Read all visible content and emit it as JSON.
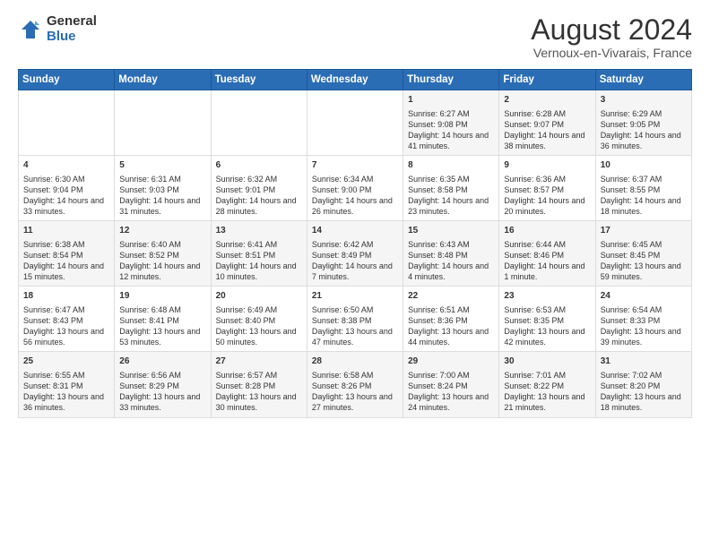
{
  "header": {
    "logo_general": "General",
    "logo_blue": "Blue",
    "month_year": "August 2024",
    "location": "Vernoux-en-Vivarais, France"
  },
  "weekdays": [
    "Sunday",
    "Monday",
    "Tuesday",
    "Wednesday",
    "Thursday",
    "Friday",
    "Saturday"
  ],
  "weeks": [
    [
      {
        "day": "",
        "content": ""
      },
      {
        "day": "",
        "content": ""
      },
      {
        "day": "",
        "content": ""
      },
      {
        "day": "",
        "content": ""
      },
      {
        "day": "1",
        "content": "Sunrise: 6:27 AM\nSunset: 9:08 PM\nDaylight: 14 hours and 41 minutes."
      },
      {
        "day": "2",
        "content": "Sunrise: 6:28 AM\nSunset: 9:07 PM\nDaylight: 14 hours and 38 minutes."
      },
      {
        "day": "3",
        "content": "Sunrise: 6:29 AM\nSunset: 9:05 PM\nDaylight: 14 hours and 36 minutes."
      }
    ],
    [
      {
        "day": "4",
        "content": "Sunrise: 6:30 AM\nSunset: 9:04 PM\nDaylight: 14 hours and 33 minutes."
      },
      {
        "day": "5",
        "content": "Sunrise: 6:31 AM\nSunset: 9:03 PM\nDaylight: 14 hours and 31 minutes."
      },
      {
        "day": "6",
        "content": "Sunrise: 6:32 AM\nSunset: 9:01 PM\nDaylight: 14 hours and 28 minutes."
      },
      {
        "day": "7",
        "content": "Sunrise: 6:34 AM\nSunset: 9:00 PM\nDaylight: 14 hours and 26 minutes."
      },
      {
        "day": "8",
        "content": "Sunrise: 6:35 AM\nSunset: 8:58 PM\nDaylight: 14 hours and 23 minutes."
      },
      {
        "day": "9",
        "content": "Sunrise: 6:36 AM\nSunset: 8:57 PM\nDaylight: 14 hours and 20 minutes."
      },
      {
        "day": "10",
        "content": "Sunrise: 6:37 AM\nSunset: 8:55 PM\nDaylight: 14 hours and 18 minutes."
      }
    ],
    [
      {
        "day": "11",
        "content": "Sunrise: 6:38 AM\nSunset: 8:54 PM\nDaylight: 14 hours and 15 minutes."
      },
      {
        "day": "12",
        "content": "Sunrise: 6:40 AM\nSunset: 8:52 PM\nDaylight: 14 hours and 12 minutes."
      },
      {
        "day": "13",
        "content": "Sunrise: 6:41 AM\nSunset: 8:51 PM\nDaylight: 14 hours and 10 minutes."
      },
      {
        "day": "14",
        "content": "Sunrise: 6:42 AM\nSunset: 8:49 PM\nDaylight: 14 hours and 7 minutes."
      },
      {
        "day": "15",
        "content": "Sunrise: 6:43 AM\nSunset: 8:48 PM\nDaylight: 14 hours and 4 minutes."
      },
      {
        "day": "16",
        "content": "Sunrise: 6:44 AM\nSunset: 8:46 PM\nDaylight: 14 hours and 1 minute."
      },
      {
        "day": "17",
        "content": "Sunrise: 6:45 AM\nSunset: 8:45 PM\nDaylight: 13 hours and 59 minutes."
      }
    ],
    [
      {
        "day": "18",
        "content": "Sunrise: 6:47 AM\nSunset: 8:43 PM\nDaylight: 13 hours and 56 minutes."
      },
      {
        "day": "19",
        "content": "Sunrise: 6:48 AM\nSunset: 8:41 PM\nDaylight: 13 hours and 53 minutes."
      },
      {
        "day": "20",
        "content": "Sunrise: 6:49 AM\nSunset: 8:40 PM\nDaylight: 13 hours and 50 minutes."
      },
      {
        "day": "21",
        "content": "Sunrise: 6:50 AM\nSunset: 8:38 PM\nDaylight: 13 hours and 47 minutes."
      },
      {
        "day": "22",
        "content": "Sunrise: 6:51 AM\nSunset: 8:36 PM\nDaylight: 13 hours and 44 minutes."
      },
      {
        "day": "23",
        "content": "Sunrise: 6:53 AM\nSunset: 8:35 PM\nDaylight: 13 hours and 42 minutes."
      },
      {
        "day": "24",
        "content": "Sunrise: 6:54 AM\nSunset: 8:33 PM\nDaylight: 13 hours and 39 minutes."
      }
    ],
    [
      {
        "day": "25",
        "content": "Sunrise: 6:55 AM\nSunset: 8:31 PM\nDaylight: 13 hours and 36 minutes."
      },
      {
        "day": "26",
        "content": "Sunrise: 6:56 AM\nSunset: 8:29 PM\nDaylight: 13 hours and 33 minutes."
      },
      {
        "day": "27",
        "content": "Sunrise: 6:57 AM\nSunset: 8:28 PM\nDaylight: 13 hours and 30 minutes."
      },
      {
        "day": "28",
        "content": "Sunrise: 6:58 AM\nSunset: 8:26 PM\nDaylight: 13 hours and 27 minutes."
      },
      {
        "day": "29",
        "content": "Sunrise: 7:00 AM\nSunset: 8:24 PM\nDaylight: 13 hours and 24 minutes."
      },
      {
        "day": "30",
        "content": "Sunrise: 7:01 AM\nSunset: 8:22 PM\nDaylight: 13 hours and 21 minutes."
      },
      {
        "day": "31",
        "content": "Sunrise: 7:02 AM\nSunset: 8:20 PM\nDaylight: 13 hours and 18 minutes."
      }
    ]
  ]
}
